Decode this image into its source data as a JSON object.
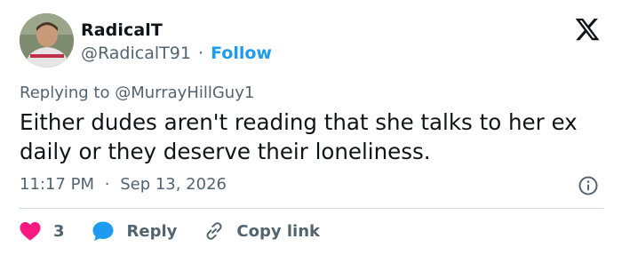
{
  "author": {
    "name": "RadicalT",
    "handle": "@RadicalT91",
    "separator": "·",
    "follow_label": "Follow"
  },
  "reply_context": {
    "prefix": "Replying to",
    "mention": "@MurrayHillGuy1"
  },
  "tweet": {
    "text": "Either dudes aren't reading that she talks to her ex daily or they deserve their loneliness.",
    "time": "11:17 PM",
    "separator": "·",
    "date": "Sep 13, 2026"
  },
  "actions": {
    "like_count": "3",
    "reply_label": "Reply",
    "copy_label": "Copy link"
  },
  "colors": {
    "accent": "#1d9bf0",
    "like": "#f91880",
    "text": "#0f1419",
    "muted": "#536471",
    "divider": "#cfd9de"
  },
  "icons": [
    "x-logo-icon",
    "info-icon",
    "heart-icon",
    "reply-bubble-icon",
    "link-icon"
  ]
}
